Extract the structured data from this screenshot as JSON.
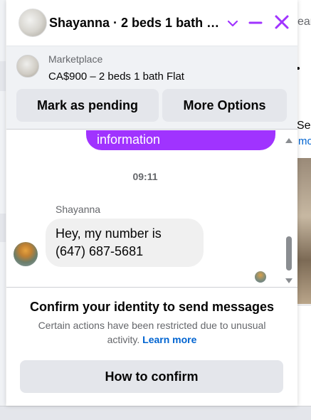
{
  "background_page": {
    "right_snippet_top": "ear",
    "right_snippet_mid": "Se",
    "right_snippet_link": "mo"
  },
  "chat": {
    "header": {
      "title": "Shayanna · 2 beds 1 bath F...",
      "accent_color": "#a033ff"
    },
    "listing": {
      "source": "Marketplace",
      "title": "CA$900 – 2 beds 1 bath Flat",
      "mark_pending_label": "Mark as pending",
      "more_options_label": "More Options"
    },
    "messages": {
      "outgoing_partial": "information",
      "timestamp": "09:11",
      "sender_name": "Shayanna",
      "incoming_line_1": "Hey, my number is",
      "incoming_line_2": "(647) 687-5681"
    },
    "restriction": {
      "title": "Confirm your identity to send messages",
      "description": "Certain actions have been restricted due to unusual activity.",
      "learn_more": "Learn more",
      "button_label": "How to confirm"
    }
  }
}
